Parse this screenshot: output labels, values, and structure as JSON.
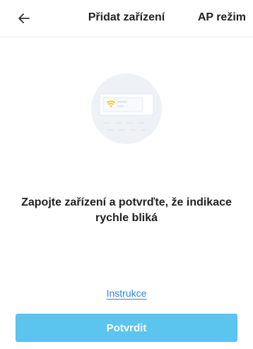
{
  "header": {
    "back_icon": "arrow-left-icon",
    "title": "Přidat zařízení",
    "ap_mode_label": "AP režim"
  },
  "illustration": {
    "icon": "router-wifi-illustration",
    "wifi_color": "#f7d23b",
    "circle_color": "#eef2f7"
  },
  "main": {
    "message": "Zapojte zařízení a potvrďte, že indikace rychle bliká"
  },
  "footer": {
    "instructions_label": "Instrukce",
    "confirm_label": "Potvrdit",
    "accent_color": "#5bc4ef",
    "link_color": "#2a8bd6"
  }
}
